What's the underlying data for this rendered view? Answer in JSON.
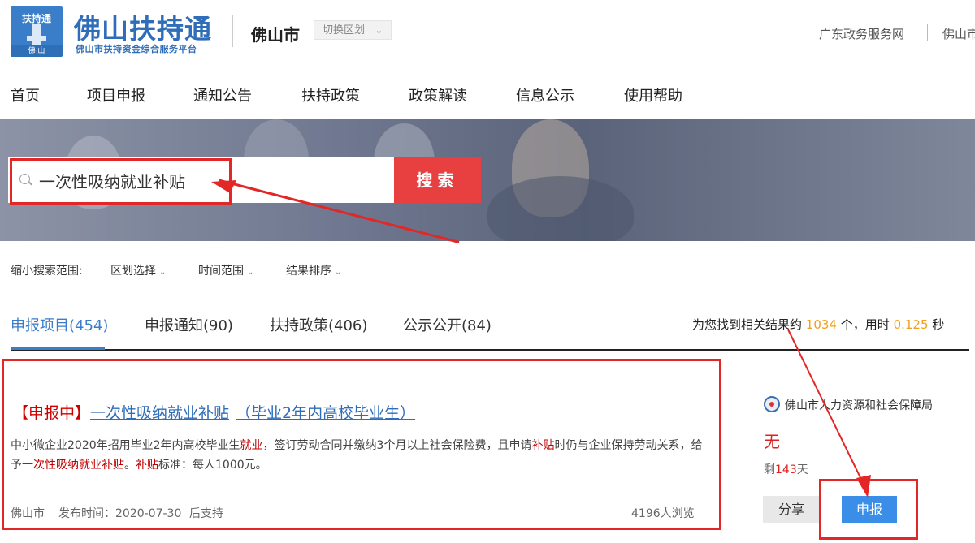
{
  "header": {
    "logo_caption": "扶持通",
    "logo_base": "佛 山",
    "brand_title": "佛山扶持通",
    "brand_subtitle": "佛山市扶持资金综合服务平台",
    "city": "佛山市",
    "switch_region": "切换区划",
    "top_links": [
      "广东政务服务网",
      "佛山市"
    ]
  },
  "nav": [
    "首页",
    "项目申报",
    "通知公告",
    "扶持政策",
    "政策解读",
    "信息公示",
    "使用帮助"
  ],
  "search": {
    "query": "一次性吸纳就业补贴",
    "button": "搜索"
  },
  "filters": {
    "label": "缩小搜索范围:",
    "options": [
      "区划选择",
      "时间范围",
      "结果排序"
    ]
  },
  "tabs": [
    "申报项目(454)",
    "申报通知(90)",
    "扶持政策(406)",
    "公示公开(84)"
  ],
  "result_summary": {
    "prefix": "为您找到相关结果约",
    "count": "1034",
    "mid": "个，用时",
    "time": "0.125",
    "suffix": "秒"
  },
  "result": {
    "status": "【申报中】",
    "name": "一次性吸纳就业补贴",
    "scope": "（毕业2年内高校毕业生）",
    "desc_1": "中小微企业2020年招用毕业2年内高校毕业生",
    "desc_kw1": "就业",
    "desc_2": "，签订劳动合同并缴纳3个月以上社会保险费，且申请",
    "desc_kw2": "补贴",
    "desc_3": "时仍与企业保持劳动关系，给予一",
    "desc_kw3": "次性吸纳就业补贴",
    "desc_4": "。",
    "desc_kw4": "补贴",
    "desc_5": "标准：每人1000元。",
    "region": "佛山市",
    "publish_label": "发布时间：",
    "publish_date": "2020-07-30",
    "support": "后支持",
    "views": "4196人浏览",
    "department": "佛山市人力资源和社会保障局",
    "amount": "无",
    "days_prefix": "剩",
    "days_num": "143",
    "days_suffix": "天",
    "share": "分享",
    "apply": "申报"
  },
  "colors": {
    "brand_blue": "#2f6db8",
    "search_red": "#e84040",
    "annotation_red": "#e32626",
    "apply_blue": "#3a8ee8",
    "highlight_orange": "#f0a020"
  }
}
